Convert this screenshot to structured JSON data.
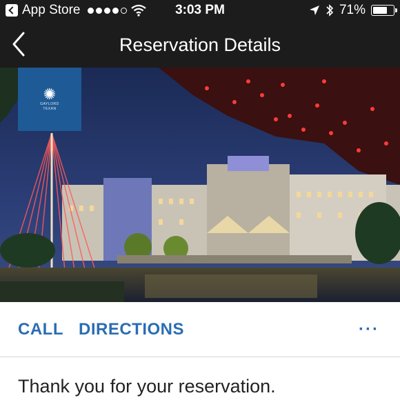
{
  "status_bar": {
    "carrier": "App Store",
    "time": "3:03 PM",
    "battery": "71%"
  },
  "nav": {
    "title": "Reservation Details"
  },
  "hero": {
    "brand_lines": [
      "GAYLORD",
      "TEXAN"
    ]
  },
  "actions": {
    "call_label": "CALL",
    "directions_label": "DIRECTIONS",
    "more_label": "···"
  },
  "content": {
    "thank_you": "Thank you for your reservation."
  },
  "colors": {
    "header_bg": "#1c1c1c",
    "accent": "#2b6db2",
    "logo_bg": "#1e5a96"
  }
}
